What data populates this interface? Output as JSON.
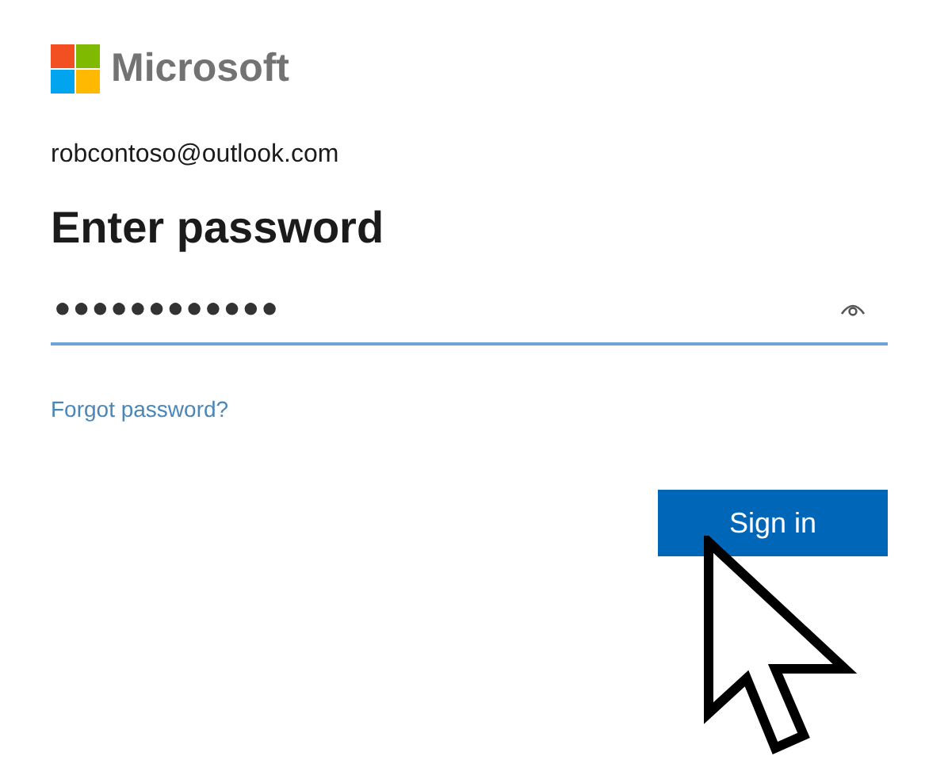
{
  "brand": {
    "name": "Microsoft"
  },
  "account": "robcontoso@outlook.com",
  "heading": "Enter password",
  "password_field": {
    "value": "●●●●●●●●●●●●"
  },
  "forgot_link": "Forgot password?",
  "sign_in_button": "Sign in"
}
